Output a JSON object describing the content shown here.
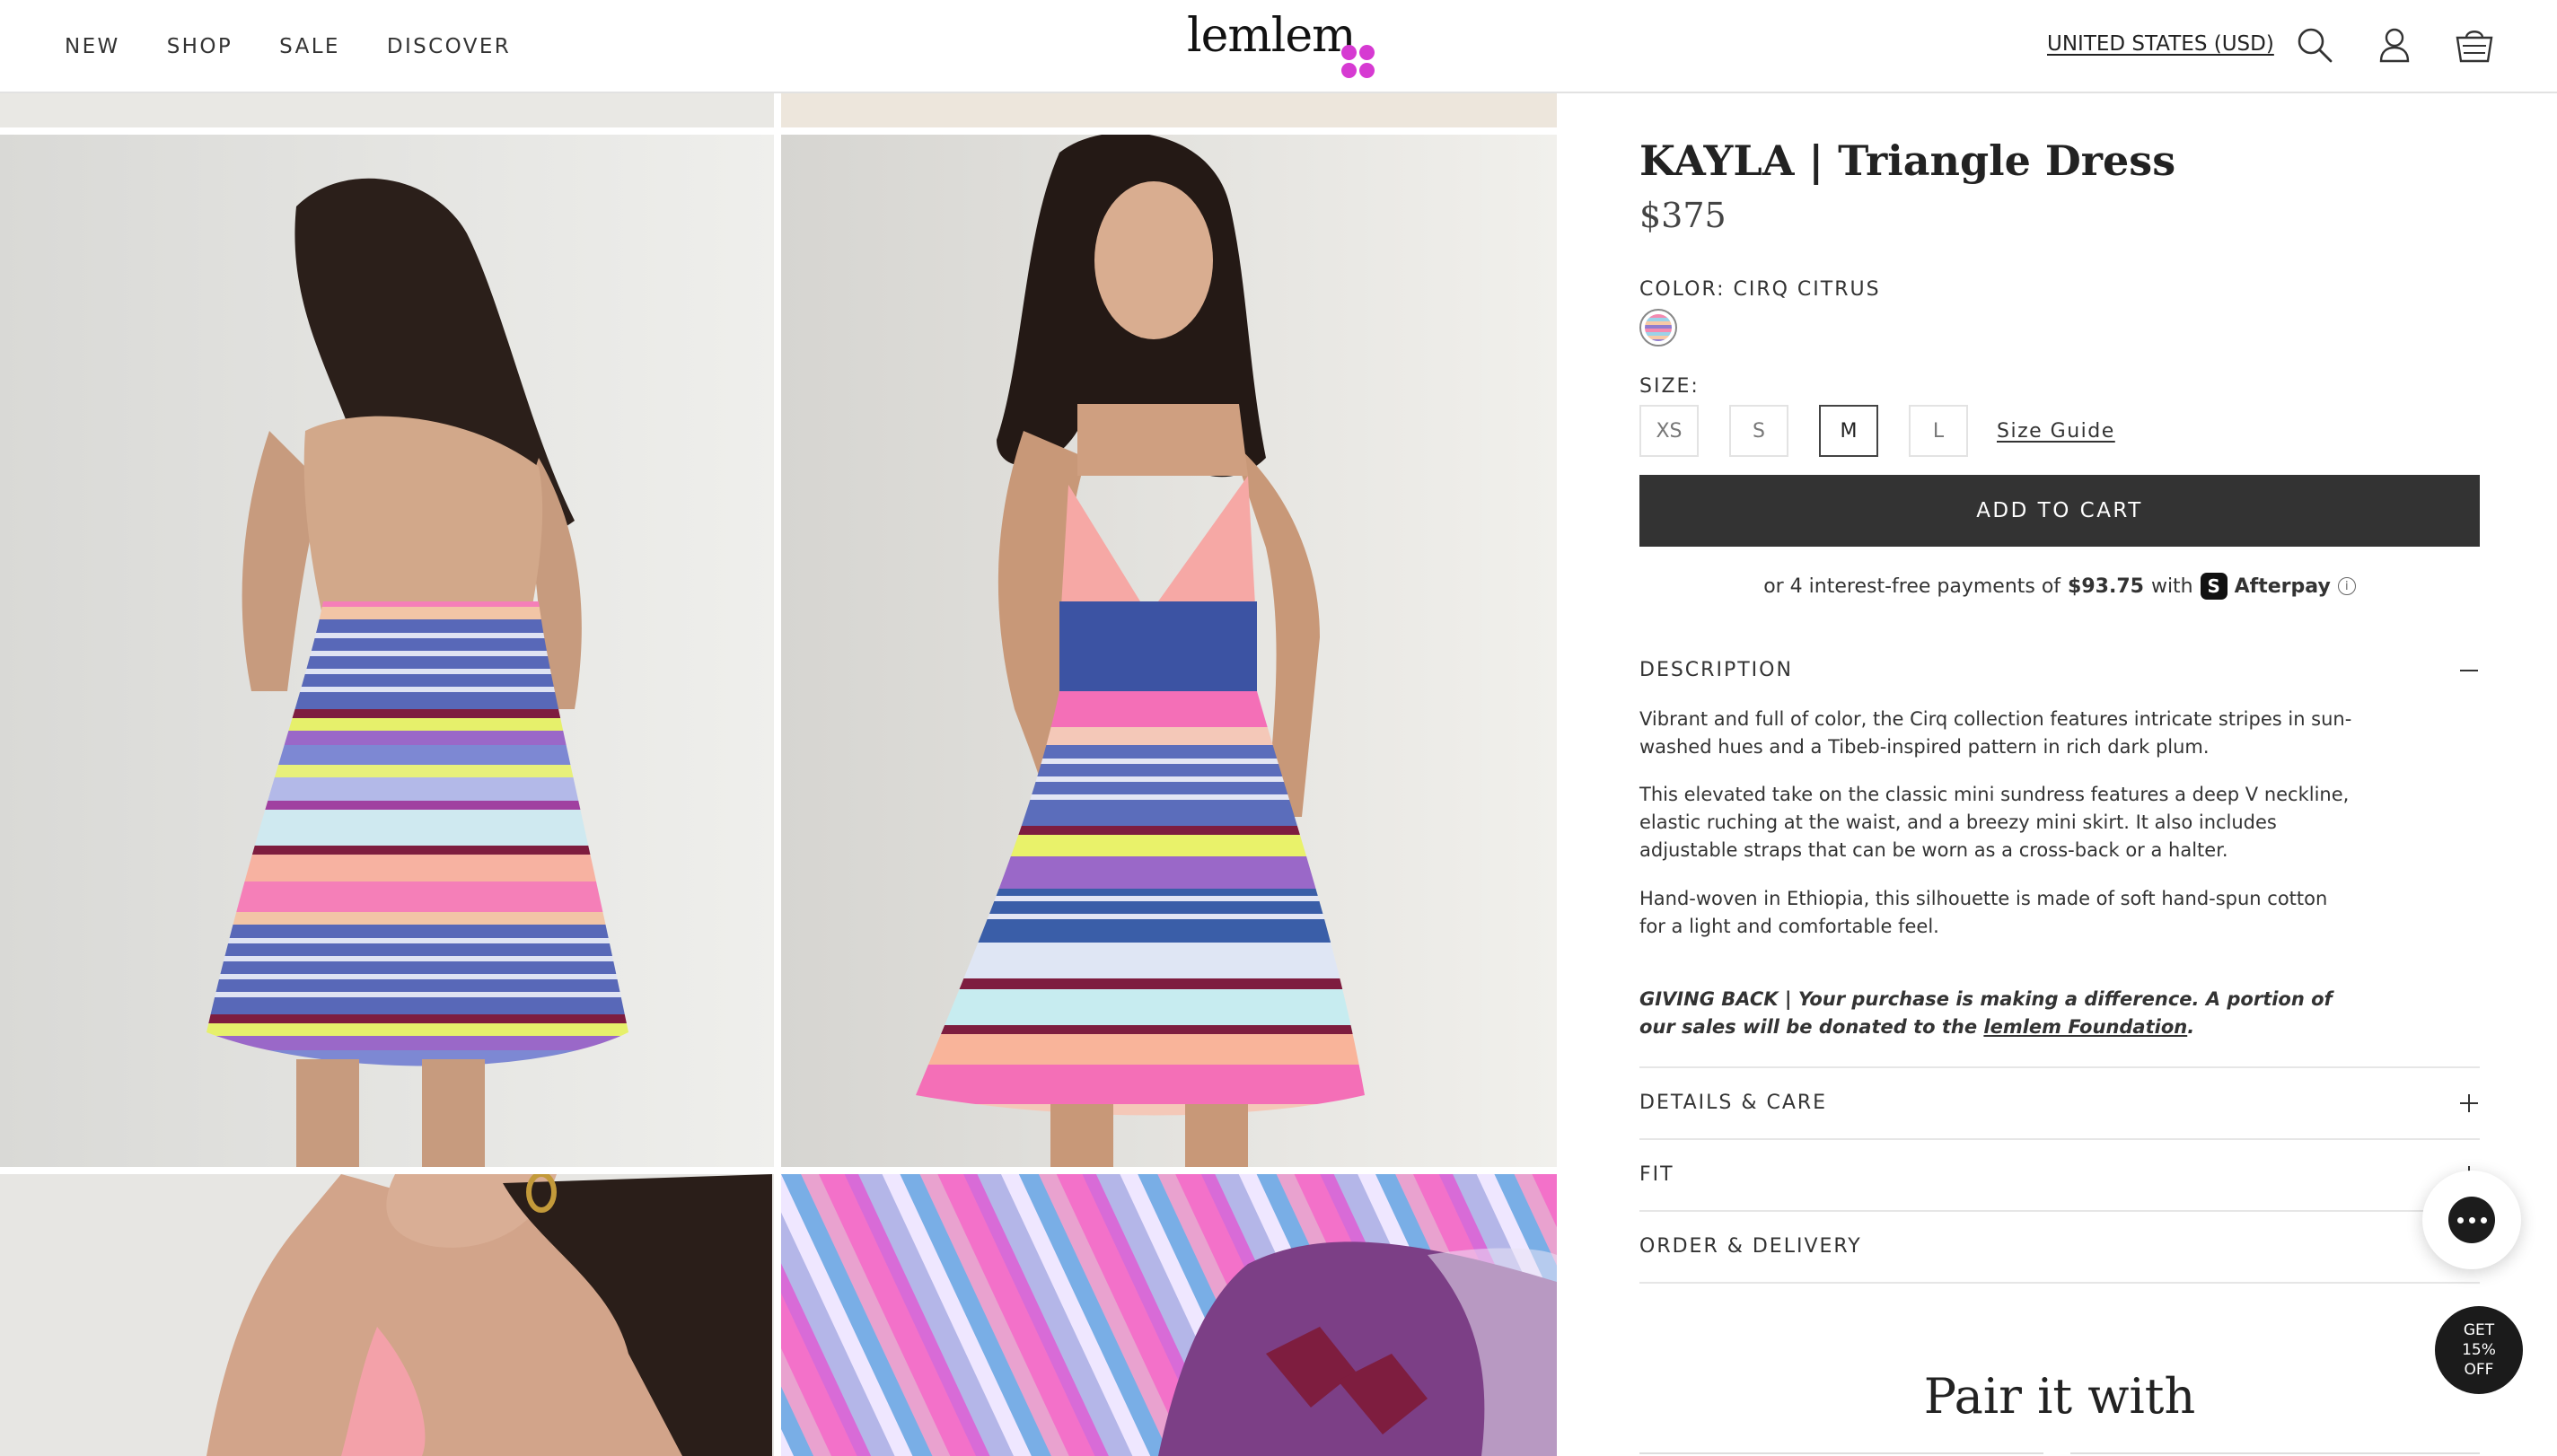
{
  "header": {
    "nav": [
      "NEW",
      "SHOP",
      "SALE",
      "DISCOVER"
    ],
    "logo": "lemlem",
    "region": "UNITED STATES (USD)",
    "icons": [
      "search-icon",
      "account-icon",
      "cart-icon"
    ]
  },
  "product": {
    "title": "KAYLA | Triangle Dress",
    "price": "$375",
    "color_label": "COLOR: CIRQ CITRUS",
    "size_label": "SIZE:",
    "sizes": [
      "XS",
      "S",
      "M",
      "L"
    ],
    "selected_size": "M",
    "size_guide": "Size Guide",
    "add_to_cart": "ADD TO CART",
    "afterpay": {
      "prefix": "or 4 interest-free payments of",
      "amount": "$93.75",
      "with": "with",
      "brand": "Afterpay"
    }
  },
  "description": {
    "heading": "DESCRIPTION",
    "p1": "Vibrant and full of color, the Cirq collection features intricate stripes in sun-washed hues and a Tibeb-inspired pattern in rich dark plum.",
    "p2": "This elevated take on the classic mini sundress features a deep V neckline, elastic ruching at the waist, and a breezy mini skirt. It also includes adjustable straps that can be worn as a cross-back or a halter.",
    "p3": "Hand-woven in Ethiopia, this silhouette is made of soft hand-spun cotton for a light and comfortable feel.",
    "giving_prefix": "GIVING BACK | Your purchase is making a difference. A portion of our sales will be donated to the",
    "giving_link": "lemlem Foundation",
    "giving_suffix": "."
  },
  "accordions": [
    "DETAILS & CARE",
    "FIT",
    "ORDER & DELIVERY"
  ],
  "pair_heading": "Pair it with",
  "promo": {
    "line1": "GET",
    "line2": "15%",
    "line3": "OFF"
  },
  "colors": {
    "button": "#333333",
    "logo_dots": "#d63ad2",
    "swatch_stripes": [
      "#f48ab0",
      "#9bd2e8",
      "#f7c9a6",
      "#8f7ccf"
    ]
  }
}
